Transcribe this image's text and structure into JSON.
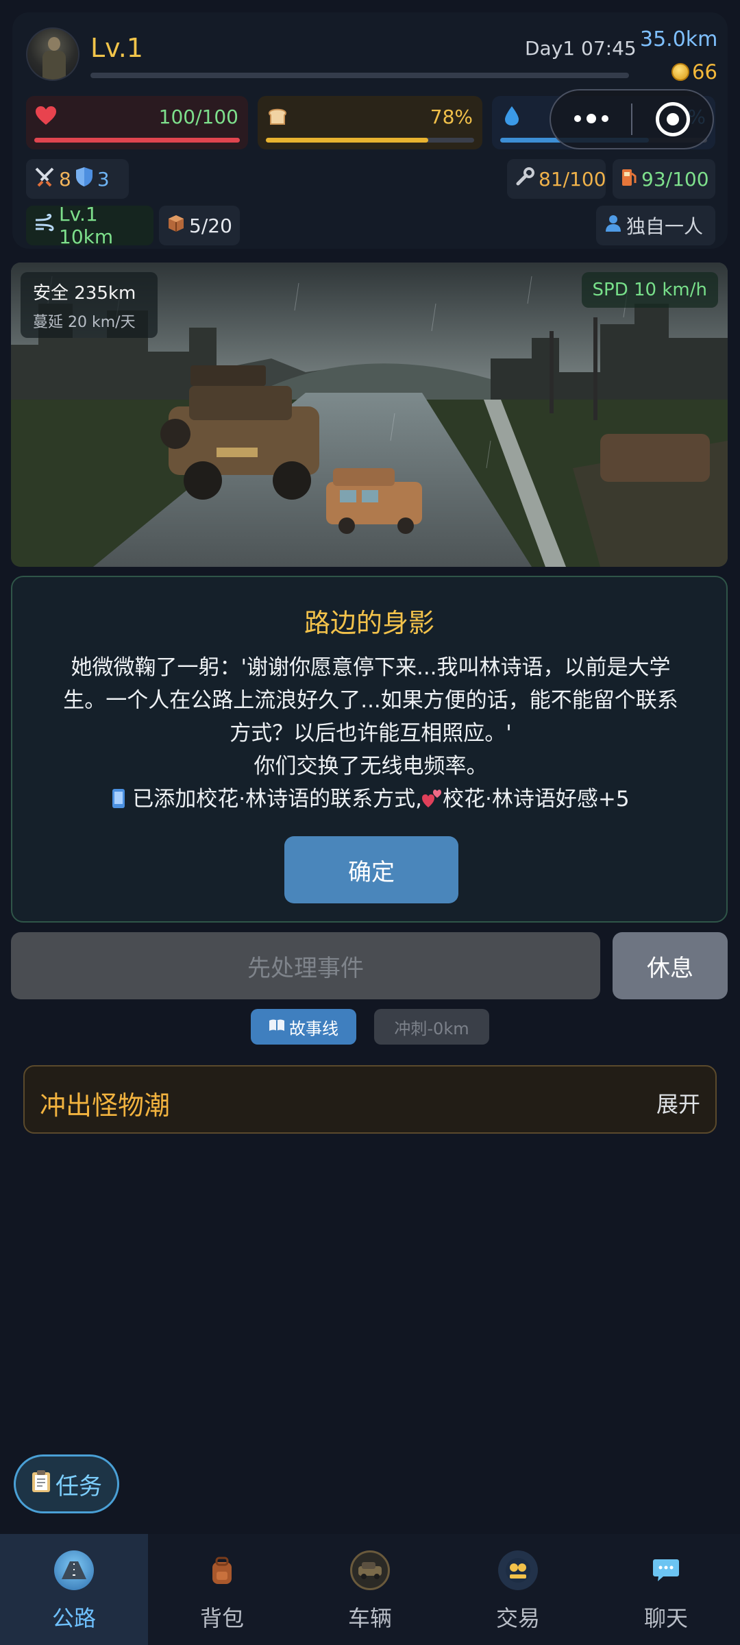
{
  "header": {
    "level": "Lv.1",
    "day_time": "Day1 07:45",
    "distance": "35.0km",
    "coins": "66"
  },
  "stats": {
    "hp": {
      "value": "100/100",
      "fraction": 1.0,
      "color": "#e0454f"
    },
    "food": {
      "value": "78%",
      "fraction": 0.78,
      "color": "#e8b330"
    },
    "water": {
      "value": "%",
      "color": "#3d8fd6"
    }
  },
  "chips": {
    "attack": "8",
    "defense": "3",
    "durability": "81/100",
    "fuel": "93/100",
    "vehicle_level": "Lv.1 10km",
    "cargo": "5/20",
    "companions": "独自一人"
  },
  "scene": {
    "safe_label": "安全 235km",
    "spread_label": "蔓延 20 km/天",
    "speed_label": "SPD 10 km/h"
  },
  "event": {
    "title": "路边的身影",
    "lines": [
      "她微微鞠了一躬：'谢谢你愿意停下来...我叫林诗语，以前是大学",
      "生。一个人在公路上流浪好久了...如果方便的话，能不能留个联系",
      "方式？以后也许能互相照应。'",
      "你们交换了无线电频率。",
      "已添加校花·林诗语的联系方式,",
      "校花·林诗语好感+5"
    ],
    "confirm_label": "确定"
  },
  "actions": {
    "handle_label": "先处理事件",
    "rest_label": "休息",
    "story_label": "故事线",
    "sprint_label": "冲刺-0km",
    "horde_title": "冲出怪物潮",
    "horde_expand": "展开",
    "task_label": "任务"
  },
  "tabs": [
    "公路",
    "背包",
    "车辆",
    "交易",
    "聊天"
  ]
}
